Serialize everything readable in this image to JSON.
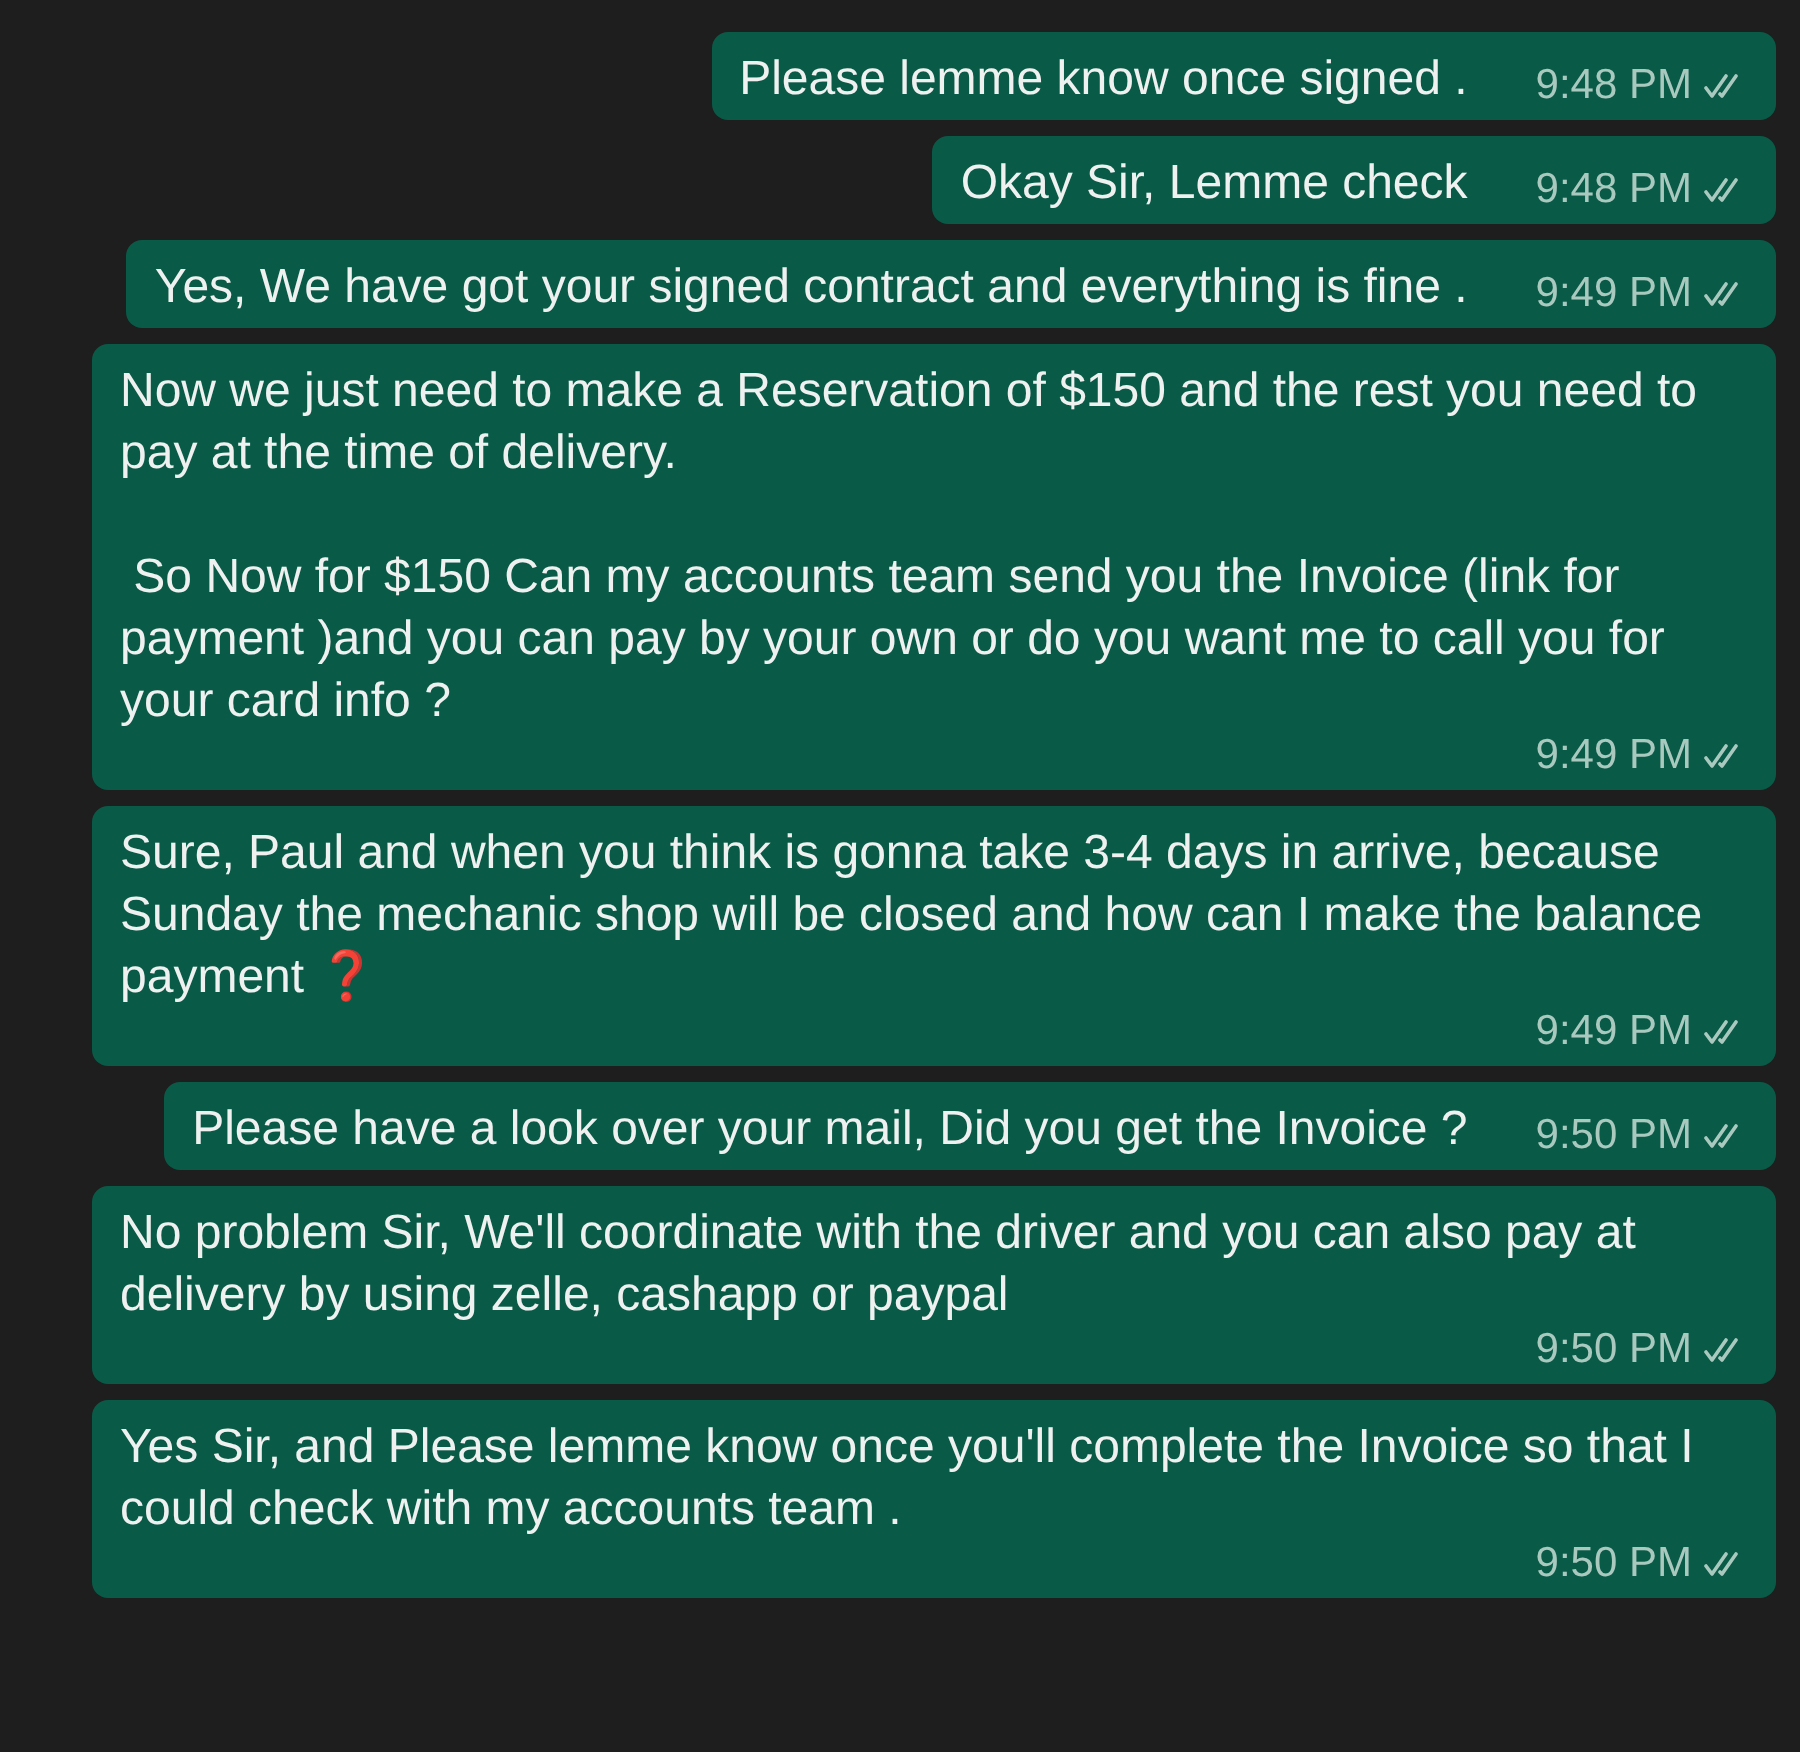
{
  "messages": [
    {
      "text": "Please lemme know once signed .",
      "time": "9:48 PM",
      "read": false
    },
    {
      "text": "Okay Sir, Lemme check",
      "time": "9:48 PM",
      "read": false
    },
    {
      "text": "Yes, We have got your signed contract and everything is fine .",
      "time": "9:49 PM",
      "read": false
    },
    {
      "text": "Now we just need to make a Reservation of $150 and the rest you need to pay at the time of delivery.\n\n So Now for $150 Can my accounts team send you the Invoice (link for payment )and you can pay by your own or do you want me to call you for your card info ?",
      "time": "9:49 PM",
      "read": false
    },
    {
      "text": "Sure, Paul and when you think is gonna take 3-4 days in arrive, because Sunday the mechanic shop will be closed and how can I make the balance payment ❓",
      "time": "9:49 PM",
      "read": false
    },
    {
      "text": "Please have a look over your mail, Did you get the Invoice ?",
      "time": "9:50 PM",
      "read": false
    },
    {
      "text": "No problem Sir, We'll coordinate with the driver and you can also pay at delivery by using zelle, cashapp or paypal",
      "time": "9:50 PM",
      "read": false
    },
    {
      "text": "Yes Sir, and Please lemme know once you'll complete the Invoice so that I could check with my accounts team .",
      "time": "9:50 PM",
      "read": false
    }
  ]
}
